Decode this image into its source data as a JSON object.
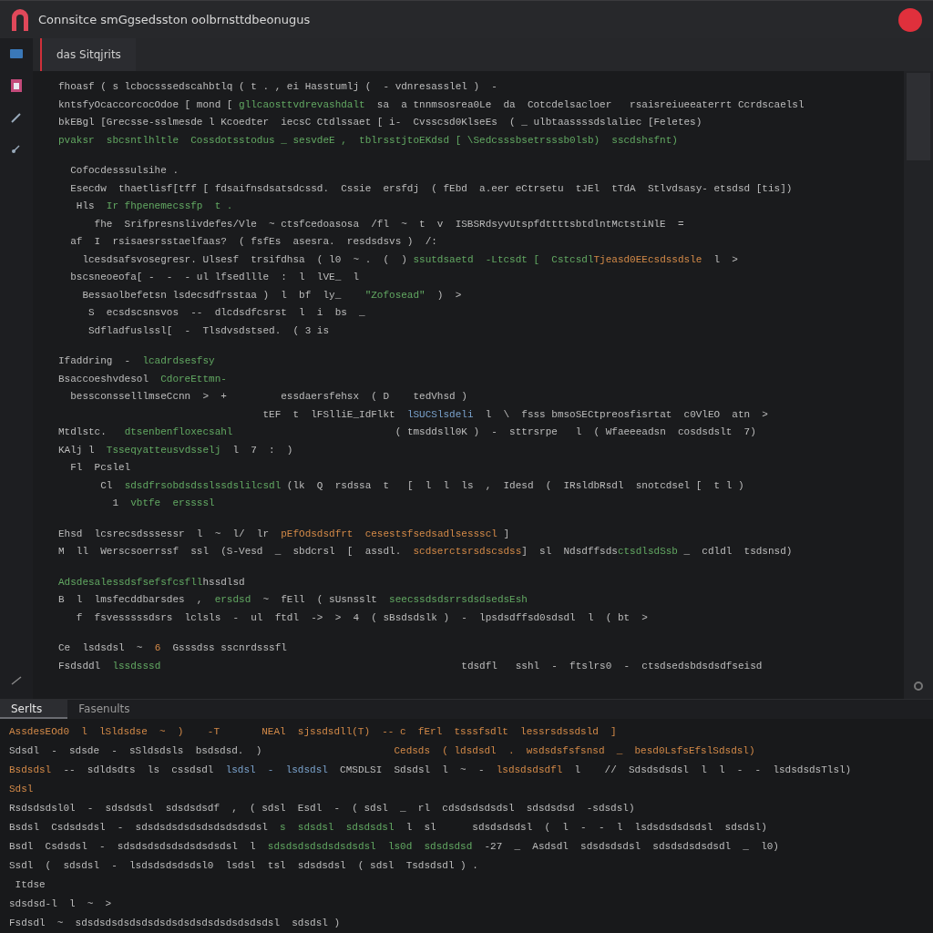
{
  "window": {
    "title": "Connsitce smGgsedsston oolbrnsttdbeonugus"
  },
  "tabs": [
    {
      "label": "das Sitqjrits",
      "selected": true
    }
  ],
  "editor": {
    "blocks": [
      {
        "lines": [
          [
            {
              "kind": "plain",
              "t": "fhoasf ( s lcbocsssedscahbtlq ( t . , ei Hasstumlj (  - vdnresasslel )  -"
            }
          ],
          [
            {
              "kind": "plain",
              "t": "kntsfyOcaccorcocOdoe [ mond [ "
            },
            {
              "kind": "string",
              "t": "gllcaosttvdrevashdalt"
            },
            {
              "kind": "plain",
              "t": "  sa  a tnnmsosrea0Le  da  Cotcdelsacloer   rsaisreiueeaterrt Ccrdscaelsl"
            }
          ],
          [
            {
              "kind": "plain",
              "t": "bkEBgl [Grecsse-sslmesde l Kcoedter  iecsC Ctdlssaet [ i-  Cvsscsd0KlseEs  ( _ ulbtaassssdslaliec [Feletes)"
            }
          ],
          [
            {
              "kind": "string",
              "t": "pvaksr  sbcsntlhltle  Cossdotsstodus _ sesvdeE ,  tblrsstjtoEKdsd [ \\Sedcsssbsetrsssb0lsb)  sscdshsfnt)"
            }
          ]
        ]
      },
      {
        "lines": [
          [
            {
              "kind": "plain",
              "t": "  Cofocdesssulsihe ."
            }
          ],
          [
            {
              "kind": "plain",
              "t": "  Esecdw  thaetlisf[tff [ fdsaifnsdsatsdcssd.  Cssie  ersfdj  ( fEbd  a.eer eCtrsetu  tJEl  tTdA  Stlvdsasy- etsdsd [tis])"
            }
          ],
          [
            {
              "kind": "plain",
              "t": "   Hls  "
            },
            {
              "kind": "string",
              "t": "Ir fhpenemecssfp  t ."
            }
          ],
          [
            {
              "kind": "plain",
              "t": "      fhe  Srifpresnslivdefes/Vle  ~ ctsfcedoasosa  /fl  ~  t  v  ISBSRdsyvUtspfdttttsbtdlntMctstiNlE  ="
            }
          ],
          [
            {
              "kind": "plain",
              "t": "  af  I  rsisaesrsstaelfaas?  ( fsfEs  asesra.  resdsdsvs )  /:"
            }
          ],
          [
            {
              "kind": "plain",
              "t": "    lcesdsafsvosegresr. Ulsesf  trsifdhsa  ( l0  ~ .  (  ) "
            },
            {
              "kind": "string",
              "t": "ssutdsaetd  -Ltcsdt [  Cstcsdl"
            },
            {
              "kind": "keyword",
              "t": "Tjeasd0EEcsdssdsle"
            },
            {
              "kind": "plain",
              "t": "  l  >"
            }
          ],
          [
            {
              "kind": "plain",
              "t": "  bscsneoeofa[ -  -  - ul lfsedllle  :  l  lVE_  l"
            }
          ],
          [
            {
              "kind": "plain",
              "t": "    Bessaolbefetsn lsdecsdfrsstaa )  l  bf  ly_    "
            },
            {
              "kind": "string",
              "t": "\"Zofosead\""
            },
            {
              "kind": "plain",
              "t": "  )  >"
            }
          ],
          [
            {
              "kind": "plain",
              "t": "     S  ecsdscsnsvos  --  dlcdsdfcsrst  l  i  bs  _"
            }
          ],
          [
            {
              "kind": "plain",
              "t": "     Sdfladfuslssl[  -  Tlsdvsdstsed.  ( 3 is"
            }
          ]
        ]
      },
      {
        "lines": [
          [
            {
              "kind": "plain",
              "t": "Ifaddring  -  "
            },
            {
              "kind": "string",
              "t": "lcadrdsesfsy"
            }
          ],
          [
            {
              "kind": "plain",
              "t": "Bsaccoeshvdesol  "
            },
            {
              "kind": "string",
              "t": "CdoreEttmn-"
            }
          ],
          [
            {
              "kind": "plain",
              "t": "  bessconsselllmseCcnn  >  +         essdaersfehsx  ( D    tedVhsd )"
            }
          ],
          [
            {
              "kind": "plain",
              "t": "                                  tEF  t  lFSlliE_IdFlkt  "
            },
            {
              "kind": "type",
              "t": "lSUCSlsdeli"
            },
            {
              "kind": "plain",
              "t": "  l  \\  fsss bmsoSECtpreosfisrtat  c0VlEO  atn  >"
            }
          ],
          [
            {
              "kind": "plain",
              "t": "Mtdlstc.   "
            },
            {
              "kind": "string",
              "t": "dtsenbenfloxecsahl"
            },
            {
              "kind": "plain",
              "t": "                           ( tmsddsll0K )  -  sttrsrpe   l  ( Wfaeeeadsn  cosdsdslt  7)"
            }
          ],
          [
            {
              "kind": "plain",
              "t": "KAlj l  "
            },
            {
              "kind": "string",
              "t": "Tsseqyatteusvdsselj"
            },
            {
              "kind": "plain",
              "t": "  l  7  :  )"
            }
          ],
          [
            {
              "kind": "plain",
              "t": "  Fl  Pcslel"
            }
          ],
          [
            {
              "kind": "plain",
              "t": "       Cl  "
            },
            {
              "kind": "string",
              "t": "sdsdfrsobdsdsslssdslilcsdl"
            },
            {
              "kind": "plain",
              "t": " (lk  Q  rsdssa  t   [  l  l  ls  ,  Idesd  (  IRsldbRsdl  snotcdsel [  t l )"
            }
          ],
          [
            {
              "kind": "plain",
              "t": "         1  "
            },
            {
              "kind": "string",
              "t": "vbtfe  erssssl"
            }
          ]
        ]
      },
      {
        "lines": [
          [
            {
              "kind": "plain",
              "t": "Ehsd  lcsrecsdsssessr  l  ~  l/  lr  "
            },
            {
              "kind": "keyword",
              "t": "pEfOdsdsdfrt  cesestsfsedsadlsessscl"
            },
            {
              "kind": "plain",
              "t": " ]"
            }
          ],
          [
            {
              "kind": "plain",
              "t": "M  ll  Werscsoerrssf  ssl  (S-Vesd  _  sbdcrsl  [  assdl.  "
            },
            {
              "kind": "keyword",
              "t": "scdserctsrsdscsdss"
            },
            {
              "kind": "plain",
              "t": "]  sl  Ndsdffsds"
            },
            {
              "kind": "string",
              "t": "ctsdlsdSsb"
            },
            {
              "kind": "plain",
              "t": " _  cdldl  tsdsnsd)"
            }
          ]
        ]
      },
      {
        "lines": [
          [
            {
              "kind": "string",
              "t": "Adsdesalessdsfsefsfcsfll"
            },
            {
              "kind": "plain",
              "t": "hssdlsd"
            }
          ],
          [
            {
              "kind": "plain",
              "t": "B  l  lmsfecddbarsdes  ,  "
            },
            {
              "kind": "string",
              "t": "ersdsd"
            },
            {
              "kind": "plain",
              "t": "  ~  fEll  ( sUsnsslt  "
            },
            {
              "kind": "string",
              "t": "seecssdsdsrrsdsdsedsEsh"
            }
          ],
          [
            {
              "kind": "plain",
              "t": "   f  fsvesssssdsrs  lclsls  -  ul  ftdl  ->  >  4  ( sBsdsdslk )  -  lpsdsdffsd0sdsdl  l  ( bt  >"
            }
          ]
        ]
      },
      {
        "lines": [
          [
            {
              "kind": "plain",
              "t": "Ce  lsdsdsl  ~  "
            },
            {
              "kind": "keyword",
              "t": "6"
            },
            {
              "kind": "plain",
              "t": "  Gsssdss sscnrdsssfl"
            }
          ],
          [
            {
              "kind": "plain",
              "t": "Fsdsddl  "
            },
            {
              "kind": "string",
              "t": "lssdsssd"
            },
            {
              "kind": "plain",
              "t": "                                                  tdsdfl   sshl  -  ftslrs0  -  ctsdsedsbdsdsdfseisd"
            }
          ]
        ]
      }
    ]
  },
  "panel": {
    "tabs": [
      {
        "label": "Serlts",
        "selected": true
      },
      {
        "label": "Fasenults",
        "selected": false
      }
    ],
    "lines": [
      [
        {
          "kind": "keyword",
          "t": "AssdesEOd0  l  lSldsdse  ~  )    -T       NEAl  sjssdsdll(T)  -- c  fErl  tsssfsdlt  lessrsdssdsld  ]"
        }
      ],
      [
        {
          "kind": "plain",
          "t": "Sdsdl  -  sdsde  -  sSldsdsls  bsdsdsd.  )                      "
        },
        {
          "kind": "keyword",
          "t": "Cedsds  ( ldsdsdl  .  wsdsdsfsfsnsd  _  besd0LsfsEfslSdsdsl)"
        }
      ],
      [
        {
          "kind": "keyword",
          "t": "Bsdsdsl"
        },
        {
          "kind": "plain",
          "t": "  --  sdldsdts  ls  cssdsdl  "
        },
        {
          "kind": "type",
          "t": "lsdsl  -  lsdsdsl"
        },
        {
          "kind": "plain",
          "t": "  CMSDLSI  Sdsdsl  l  ~  -  "
        },
        {
          "kind": "keyword",
          "t": "lsdsdsdsdfl"
        },
        {
          "kind": "plain",
          "t": "  l    //  Sdsdsdsdsl  l  l  -  -  lsdsdsdsTlsl)"
        }
      ],
      [
        {
          "kind": "keyword",
          "t": "Sdsl"
        }
      ],
      [
        {
          "kind": "plain",
          "t": "Rsdsdsdsl0l  -  sdsdsdsl  sdsdsdsdf  ,  ( sdsl  Esdl  -  ( sdsl  _  rl  cdsdsdsdsdsl  sdsdsdsd  -sdsdsl)"
        }
      ],
      [
        {
          "kind": "plain",
          "t": "Bsdsl  Csdsdsdsl  -  sdsdsdsdsdsdsdsdsdsdsl  "
        },
        {
          "kind": "string",
          "t": "s  sdsdsl  sdsdsdsl"
        },
        {
          "kind": "plain",
          "t": "  l  sl      sdsdsdsdsl  (  l  -  -  l  lsdsdsdsdsdsl  sdsdsl)"
        }
      ],
      [
        {
          "kind": "plain",
          "t": "Bsdl  Csdsdsl  -  sdsdsdsdsdsdsdsdsdsl  l  "
        },
        {
          "kind": "string",
          "t": "sdsdsdsdsdsdsdsdsl  ls0d  sdsdsdsd"
        },
        {
          "kind": "plain",
          "t": "  -27  _  Asdsdl  sdsdsdsdsl  sdsdsdsdsdsdl  _  l0)"
        }
      ],
      [
        {
          "kind": "plain",
          "t": "Ssdl  (  sdsdsl  -  lsdsdsdsdsdsl0  lsdsl  tsl  sdsdsdsl  ( sdsl  Tsdsdsdl ) ."
        }
      ],
      [
        {
          "kind": "plain",
          "t": " Itdse"
        }
      ],
      [
        {
          "kind": "plain",
          "t": "sdsdsd-l  l  ~  >"
        }
      ],
      [
        {
          "kind": "plain",
          "t": "Fsdsdl  ~  sdsdsdsdsdsdsdsdsdsdsdsdsdsdsdsdsl  sdsdsl )"
        }
      ]
    ]
  }
}
